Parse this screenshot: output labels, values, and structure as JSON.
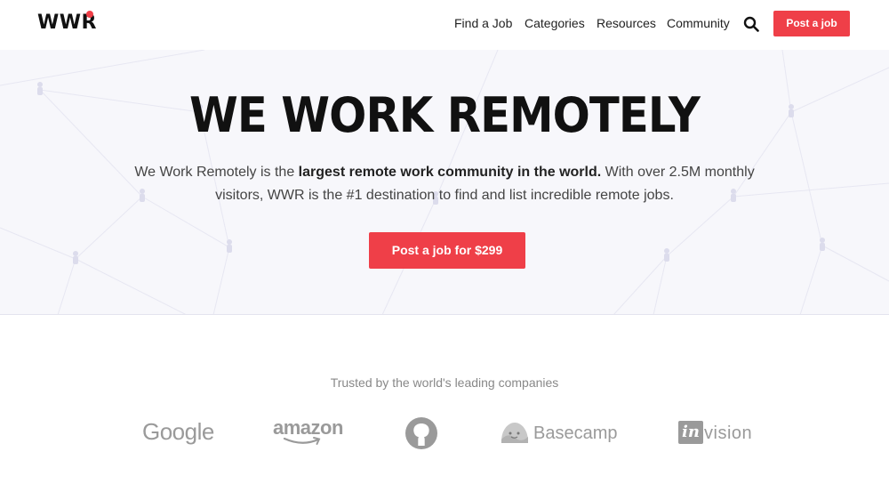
{
  "header": {
    "logo": "WWR",
    "nav": [
      "Find a Job",
      "Categories",
      "Resources",
      "Community"
    ],
    "post_button": "Post a job"
  },
  "hero": {
    "title": "WE WORK REMOTELY",
    "desc_lead": "We Work Remotely is the ",
    "desc_bold": "largest remote work community in the world.",
    "desc_rest": " With over 2.5M monthly visitors, WWR is the #1 destination to find and list incredible remote jobs.",
    "cta": "Post a job for $299"
  },
  "trusted": {
    "heading": "Trusted by the world's leading companies",
    "logos": [
      "Google",
      "amazon",
      "github-icon",
      "Basecamp",
      "invision"
    ],
    "invision_mark": "in",
    "invision_word": "vision"
  },
  "colors": {
    "accent": "#ef3f48",
    "hero_bg": "#f7f7fb",
    "logo_gray": "#9a9a9a"
  }
}
